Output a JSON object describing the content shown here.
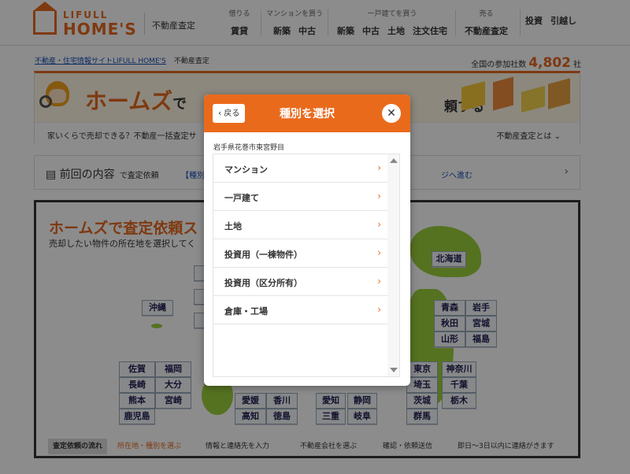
{
  "header": {
    "logo_top": "LIFULL",
    "logo_bottom": "HOME'S",
    "section": "不動産査定",
    "nav": [
      {
        "caption": "借りる",
        "items": [
          "賃貸"
        ]
      },
      {
        "caption": "マンションを買う",
        "items": [
          "新築",
          "中古"
        ]
      },
      {
        "caption": "一戸建てを買う",
        "items": [
          "新築",
          "中古",
          "土地",
          "注文住宅"
        ]
      },
      {
        "caption": "売る",
        "items": [
          "不動産査定"
        ]
      },
      {
        "caption": "",
        "items": [
          "投資",
          "引越し"
        ]
      }
    ]
  },
  "breadcrumb": {
    "link": "不動産・住宅情報サイトLIFULL HOME'S",
    "current": "不動産査定"
  },
  "participants": {
    "prefix": "全国の参加社数",
    "number": "4,802",
    "suffix": "社"
  },
  "banner": {
    "title": "ホームズ",
    "title_suffix": "で",
    "right_text": "頼する",
    "question": "家いくらで売却できる？不動産一括査定サ",
    "about": "不動産査定とは ⌄"
  },
  "previous": {
    "title": "前回の内容",
    "subtitle": "で査定依頼",
    "link1": "【種別",
    "link2": "ジへ進む",
    "arrow": "›"
  },
  "map_section": {
    "heading": "ホームズで査定依頼ス",
    "subheading": "売却したい物件の所在地を選択してく",
    "prefectures": [
      {
        "name": "北海道"
      },
      {
        "name": "沖縄"
      },
      {
        "name": "青森"
      },
      {
        "name": "岩手"
      },
      {
        "name": "秋田"
      },
      {
        "name": "宮城"
      },
      {
        "name": "山形"
      },
      {
        "name": "福島"
      },
      {
        "name": "東京"
      },
      {
        "name": "神奈川"
      },
      {
        "name": "埼玉"
      },
      {
        "name": "千葉"
      },
      {
        "name": "茨城"
      },
      {
        "name": "栃木"
      },
      {
        "name": "群馬"
      },
      {
        "name": "佐賀"
      },
      {
        "name": "福岡"
      },
      {
        "name": "長崎"
      },
      {
        "name": "大分"
      },
      {
        "name": "熊本"
      },
      {
        "name": "宮崎"
      },
      {
        "name": "鹿児島"
      },
      {
        "name": "愛媛"
      },
      {
        "name": "香川"
      },
      {
        "name": "高知"
      },
      {
        "name": "徳島"
      },
      {
        "name": "愛知"
      },
      {
        "name": "静岡"
      },
      {
        "name": "三重"
      },
      {
        "name": "岐阜"
      }
    ],
    "steps_label": "査定依頼の流れ",
    "steps": [
      "所在地・種別を選ぶ",
      "情報と連絡先を入力",
      "不動産会社を選ぶ",
      "確認・依頼送信",
      "即日〜3日以内に連絡がきます"
    ]
  },
  "modal": {
    "back": "戻る",
    "title": "種別を選択",
    "close": "✕",
    "location": "岩手県花巻市東宮野目",
    "options": [
      "マンション",
      "一戸建て",
      "土地",
      "投資用（一棟物件）",
      "投資用（区分所有）",
      "倉庫・工場"
    ],
    "arrow": "›"
  }
}
